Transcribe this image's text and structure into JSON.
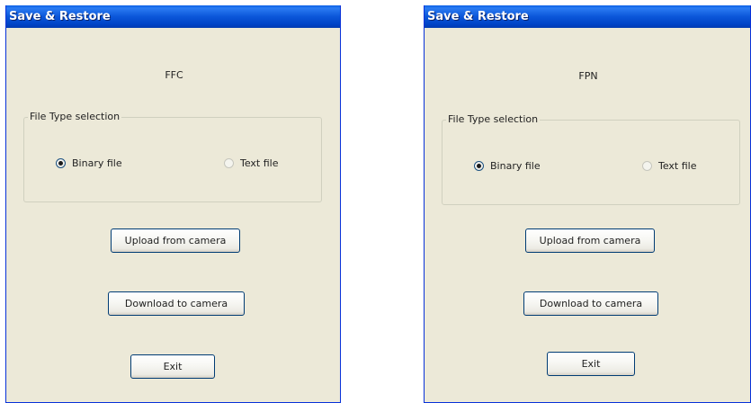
{
  "windows": [
    {
      "title": "Save & Restore",
      "mode": "FFC",
      "group": {
        "title": "File Type selection",
        "options": [
          {
            "label": "Binary file",
            "selected": true
          },
          {
            "label": "Text file",
            "selected": false
          }
        ]
      },
      "buttons": {
        "upload": "Upload from camera",
        "download": "Download to camera",
        "exit": "Exit"
      }
    },
    {
      "title": "Save & Restore",
      "mode": "FPN",
      "group": {
        "title": "File Type selection",
        "options": [
          {
            "label": "Binary file",
            "selected": true
          },
          {
            "label": "Text file",
            "selected": false
          }
        ]
      },
      "buttons": {
        "upload": "Upload from camera",
        "download": "Download to camera",
        "exit": "Exit"
      }
    }
  ],
  "colors": {
    "titlebar": "#0b56d9",
    "window_bg": "#ece9d8",
    "button_border": "#003c74"
  }
}
